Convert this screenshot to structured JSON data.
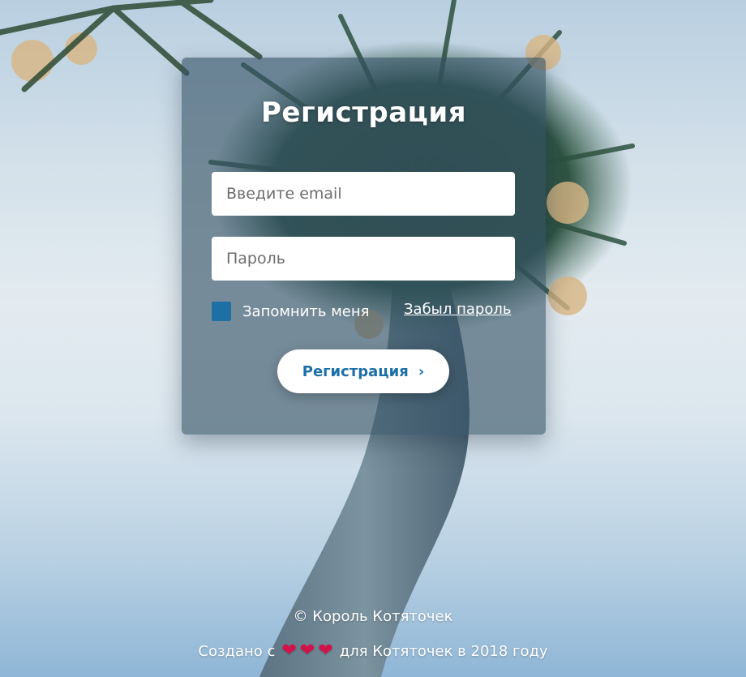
{
  "form": {
    "title": "Регистрация",
    "email_placeholder": "Введите email",
    "password_placeholder": "Пароль",
    "remember_label": "Запомнить меня",
    "forgot_label": "Забыл пароль",
    "submit_label": "Регистрация",
    "submit_icon": "chevron-right-icon"
  },
  "footer": {
    "copyright": "© Король Котяточек",
    "made_prefix": "Создано с",
    "heart_glyph": "❤",
    "made_suffix": "для Котяточек в 2018 году"
  },
  "colors": {
    "accent": "#1c6fa9",
    "checkbox": "#1d6fa4",
    "heart": "#d3124a",
    "card_overlay": "rgba(52,80,100,0.62)"
  }
}
